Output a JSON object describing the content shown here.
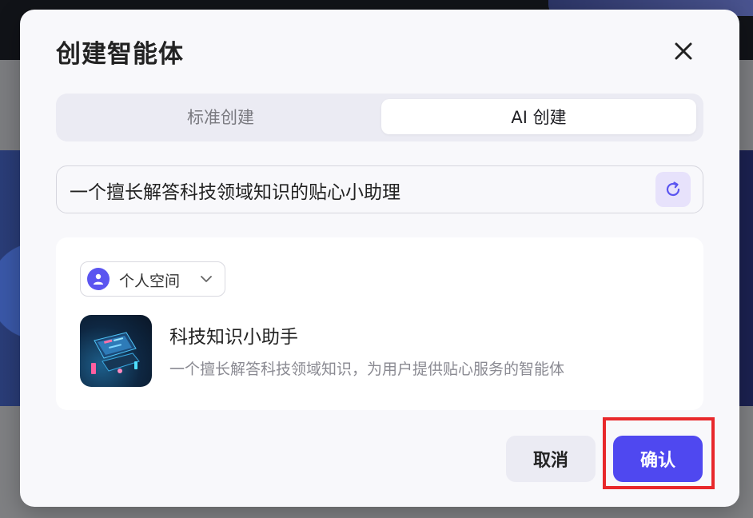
{
  "dialog": {
    "title": "创建智能体",
    "tabs": [
      {
        "label": "标准创建",
        "active": false
      },
      {
        "label": "AI 创建",
        "active": true
      }
    ],
    "prompt": {
      "value": "一个擅长解答科技领域知识的贴心小助理"
    },
    "space_select": {
      "selected": "个人空间"
    },
    "agent": {
      "name": "科技知识小助手",
      "description": "一个擅长解答科技领域知识，为用户提供贴心服务的智能体"
    },
    "buttons": {
      "cancel": "取消",
      "confirm": "确认"
    }
  },
  "colors": {
    "accent": "#4f48f0",
    "highlight": "#e8282b",
    "tab_bg": "#ebebf3"
  },
  "icons": [
    "close-icon",
    "refresh-icon",
    "user-icon",
    "chevron-down-icon"
  ]
}
